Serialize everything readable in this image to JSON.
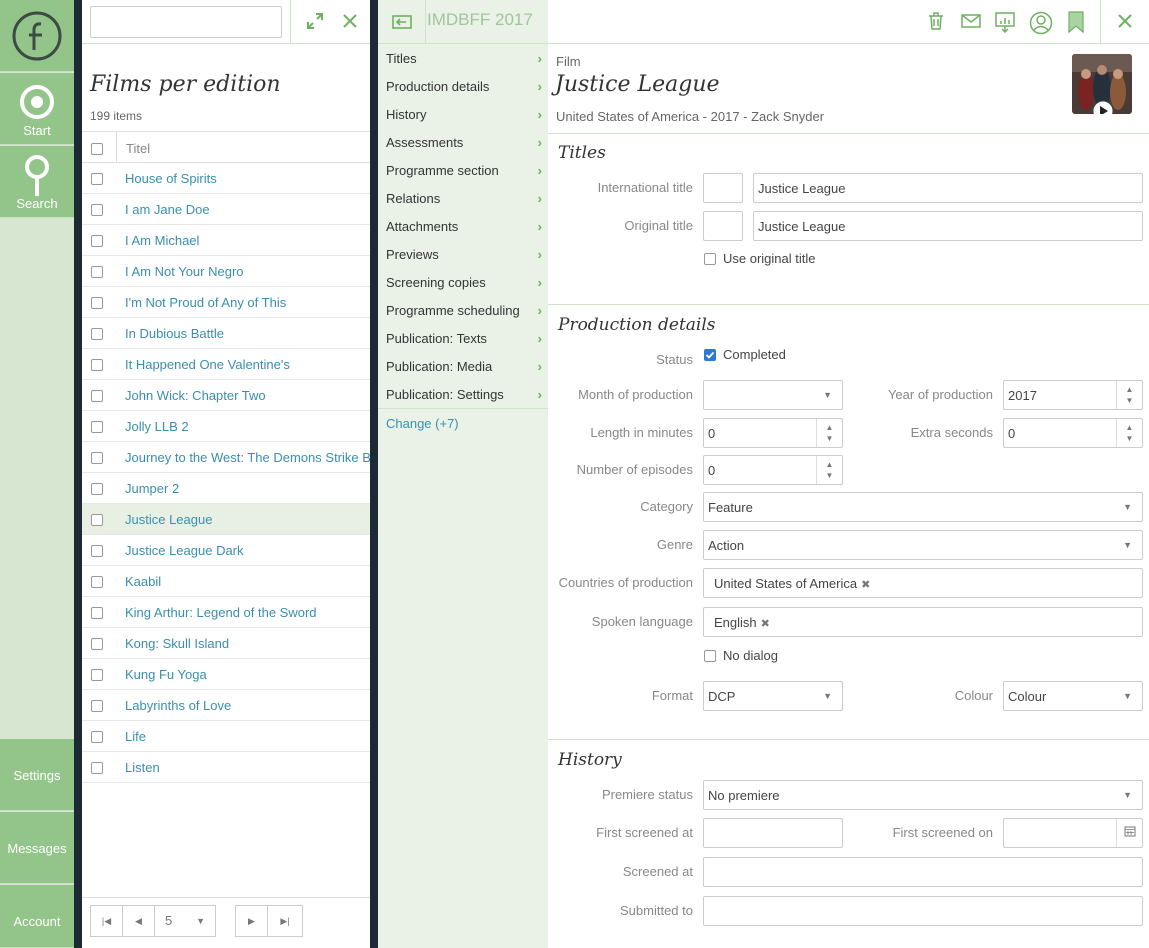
{
  "rail": {
    "start_label": "Start",
    "search_label": "Search",
    "settings_label": "Settings",
    "messages_label": "Messages",
    "account_label": "Account"
  },
  "list": {
    "search_placeholder": "",
    "title": "Films per edition",
    "count": "199 items",
    "column_header": "Titel",
    "items": [
      {
        "title": "House of Spirits",
        "selected": false
      },
      {
        "title": "I am Jane Doe",
        "selected": false
      },
      {
        "title": "I Am Michael",
        "selected": false
      },
      {
        "title": "I Am Not Your Negro",
        "selected": false
      },
      {
        "title": "I'm Not Proud of Any of This",
        "selected": false
      },
      {
        "title": "In Dubious Battle",
        "selected": false
      },
      {
        "title": "It Happened One Valentine's",
        "selected": false
      },
      {
        "title": "John Wick: Chapter Two",
        "selected": false
      },
      {
        "title": "Jolly LLB 2",
        "selected": false
      },
      {
        "title": "Journey to the West: The Demons Strike Back",
        "selected": false
      },
      {
        "title": "Jumper 2",
        "selected": false
      },
      {
        "title": "Justice League",
        "selected": true
      },
      {
        "title": "Justice League Dark",
        "selected": false
      },
      {
        "title": "Kaabil",
        "selected": false
      },
      {
        "title": "King Arthur: Legend of the Sword",
        "selected": false
      },
      {
        "title": "Kong: Skull Island",
        "selected": false
      },
      {
        "title": "Kung Fu Yoga",
        "selected": false
      },
      {
        "title": "Labyrinths of Love",
        "selected": false
      },
      {
        "title": "Life",
        "selected": false
      },
      {
        "title": "Listen",
        "selected": false
      }
    ],
    "pager": {
      "page": "5"
    }
  },
  "menu": {
    "items": [
      "Titles",
      "Production details",
      "History",
      "Assessments",
      "Programme section",
      "Relations",
      "Attachments",
      "Previews",
      "Screening copies",
      "Programme scheduling",
      "Publication: Texts",
      "Publication: Media",
      "Publication: Settings"
    ],
    "change_link": "Change (+7)"
  },
  "detail": {
    "edition": "IMDBFF 2017",
    "type_label": "Film",
    "name": "Justice League",
    "subtitle": "United States of America - 2017 - Zack Snyder",
    "titles": {
      "section": "Titles",
      "international_label": "International title",
      "international_prefix": "",
      "international_value": "Justice League",
      "original_label": "Original title",
      "original_prefix": "",
      "original_value": "Justice League",
      "use_original_label": "Use original title"
    },
    "production": {
      "section": "Production details",
      "status_label": "Status",
      "status_value": "Completed",
      "month_label": "Month of production",
      "month_value": "",
      "year_label": "Year of production",
      "year_value": "2017",
      "length_label": "Length in minutes",
      "length_value": "0",
      "extra_label": "Extra seconds",
      "extra_value": "0",
      "episodes_label": "Number of episodes",
      "episodes_value": "0",
      "category_label": "Category",
      "category_value": "Feature",
      "genre_label": "Genre",
      "genre_value": "Action",
      "countries_label": "Countries of production",
      "countries_value": "United States of America",
      "language_label": "Spoken language",
      "language_value": "English",
      "no_dialog_label": "No dialog",
      "format_label": "Format",
      "format_value": "DCP",
      "colour_label": "Colour",
      "colour_value": "Colour"
    },
    "history": {
      "section": "History",
      "premiere_label": "Premiere status",
      "premiere_value": "No premiere",
      "first_at_label": "First screened at",
      "first_at_value": "",
      "first_on_label": "First screened on",
      "first_on_value": "",
      "screened_label": "Screened at",
      "screened_value": "",
      "submitted_label": "Submitted to",
      "submitted_value": ""
    }
  },
  "colors": {
    "rail_tile": "#93c58a",
    "rail_bg": "#d6e6d0",
    "accent_green": "#6fb062",
    "link_blue": "#3a8fb0",
    "menu_bg": "#eaf2e7"
  }
}
